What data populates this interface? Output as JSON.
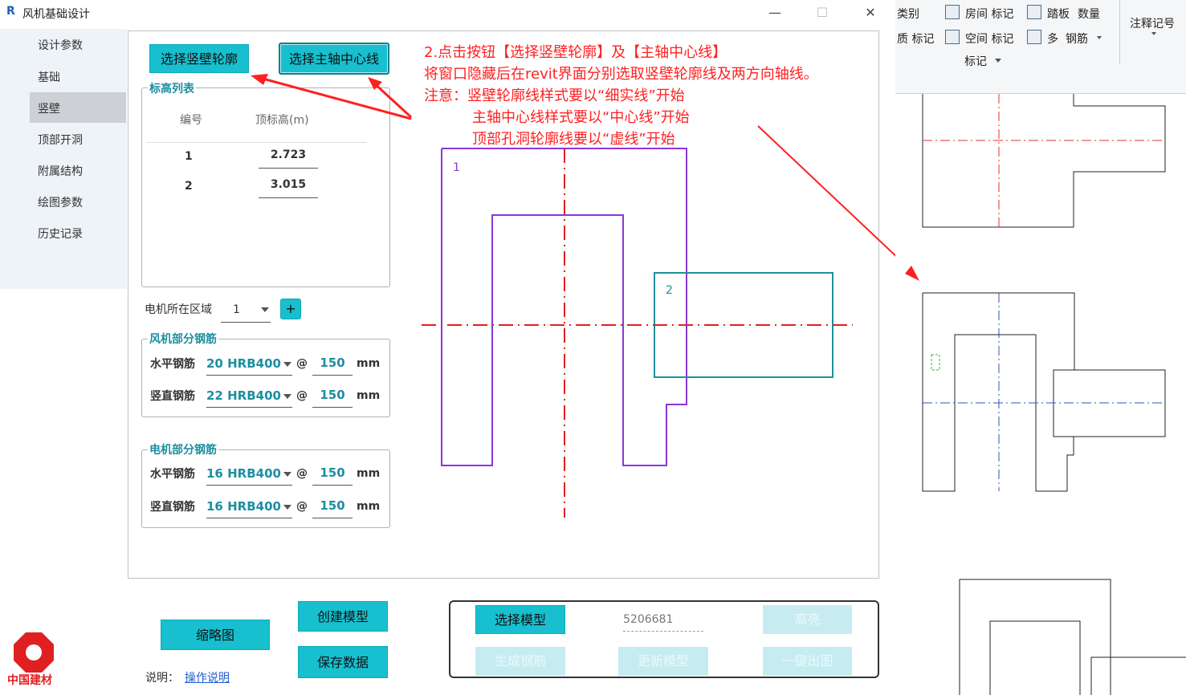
{
  "window": {
    "title": "风机基础设计",
    "logo": "R",
    "min": "—",
    "max": "☐",
    "close": "✕"
  },
  "sidebar": {
    "items": [
      "设计参数",
      "基础",
      "竖壁",
      "顶部开洞",
      "附属结构",
      "绘图参数",
      "历史记录"
    ]
  },
  "top_buttons": {
    "select_wall": "选择竖壁轮廓",
    "select_axis": "选择主轴中心线"
  },
  "elevation_list": {
    "title": "标高列表",
    "headers": [
      "编号",
      "顶标高(m)"
    ],
    "rows": [
      {
        "id": "1",
        "elev": "2.723"
      },
      {
        "id": "2",
        "elev": "3.015"
      }
    ]
  },
  "motor_zone": {
    "label": "电机所在区域",
    "value": "1",
    "add": "+"
  },
  "fan_rebar": {
    "title": "风机部分钢筋",
    "horizontal": {
      "label": "水平钢筋",
      "bar": "20 HRB400",
      "at": "@",
      "spacing": "150",
      "unit": "mm"
    },
    "vertical": {
      "label": "竖直钢筋",
      "bar": "22 HRB400",
      "at": "@",
      "spacing": "150",
      "unit": "mm"
    }
  },
  "motor_rebar": {
    "title": "电机部分钢筋",
    "horizontal": {
      "label": "水平钢筋",
      "bar": "16 HRB400",
      "at": "@",
      "spacing": "150",
      "unit": "mm"
    },
    "vertical": {
      "label": "竖直钢筋",
      "bar": "16 HRB400",
      "at": "@",
      "spacing": "150",
      "unit": "mm"
    }
  },
  "annotation": {
    "line1": "2.点击按钮【选择竖壁轮廓】及【主轴中心线】",
    "line2": "将窗口隐藏后在revit界面分别选取竖壁轮廓线及两方向轴线。",
    "line3": "注意：竖壁轮廓线样式要以“细实线”开始",
    "line4": "主轴中心线样式要以“中心线”开始",
    "line5": "顶部孔洞轮廓线要以“虚线”开始"
  },
  "drawing": {
    "label1": "1",
    "label2": "2"
  },
  "bottom": {
    "thumbnail": "缩略图",
    "create_model": "创建模型",
    "save_data": "保存数据",
    "select_model": "选择模型",
    "model_id": "5206681",
    "highlight": "高亮",
    "gen_rebar": "生成钢筋",
    "update_model": "更新模型",
    "one_click": "一键出图",
    "note_label": "说明：",
    "note_link": "操作说明",
    "brand": "中国建材"
  },
  "revit": {
    "row1": [
      "类别",
      "房间 标记",
      "踏板",
      "数量"
    ],
    "row2": [
      "质 标记",
      "空间 标记",
      "多",
      "钢筋"
    ],
    "group": "标记",
    "annot": "注释记号"
  }
}
